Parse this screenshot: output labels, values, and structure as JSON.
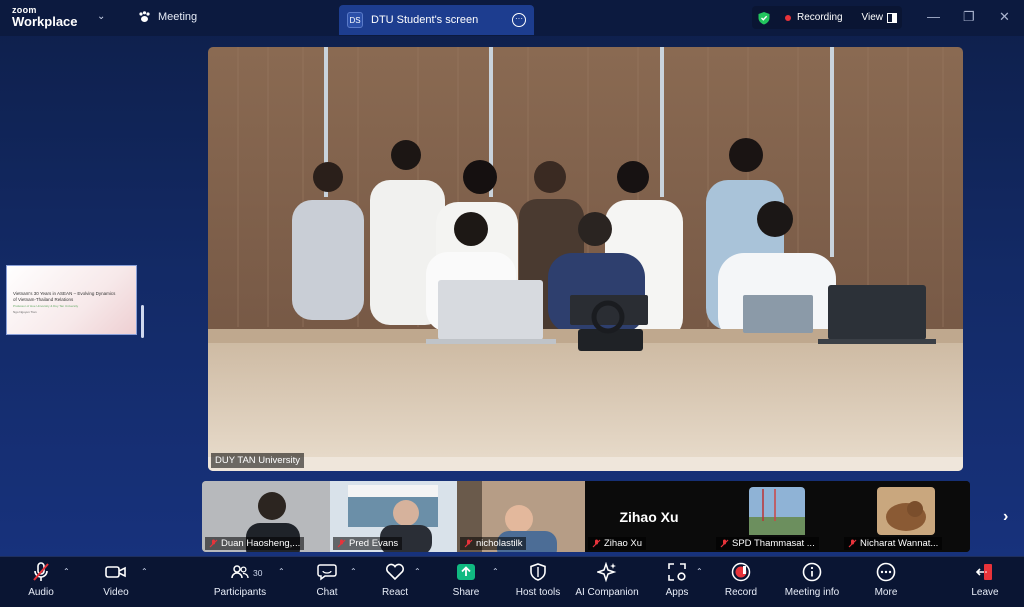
{
  "app": {
    "brand_top": "zoom",
    "brand_bottom": "Workplace",
    "meeting_label": "Meeting"
  },
  "share_tab": {
    "initials": "DS",
    "title": "DTU Student's screen"
  },
  "status": {
    "recording_label": "Recording",
    "view_label": "View"
  },
  "side_slide": {
    "title": "Vietnam's 30 Years in ASEAN – Evolving Dynamics of Vietnam-Thailand Relations",
    "line2": "Professor of Hue University & Duy Tan University",
    "line3": "Ngo Nguyen Tran"
  },
  "main_video": {
    "label": "DUY TAN University"
  },
  "participants_strip": [
    {
      "name": "Duan Haosheng,..."
    },
    {
      "name": "Pred Evans"
    },
    {
      "name": "nicholastilk"
    },
    {
      "name": "Zihao Xu",
      "display": "Zihao Xu"
    },
    {
      "name": "SPD Thammasat ..."
    },
    {
      "name": "Nicharat Wannat..."
    }
  ],
  "toolbar": {
    "audio": "Audio",
    "video": "Video",
    "participants": "Participants",
    "participants_count": "30",
    "chat": "Chat",
    "react": "React",
    "share": "Share",
    "host_tools": "Host tools",
    "ai_companion": "AI Companion",
    "apps": "Apps",
    "record": "Record",
    "meeting_info": "Meeting info",
    "more": "More",
    "leave": "Leave"
  },
  "colors": {
    "background": "#132a66",
    "toolbar": "#0a1533",
    "share_green": "#10b981",
    "leave_red": "#e8333a",
    "record_red": "#e8333a"
  }
}
